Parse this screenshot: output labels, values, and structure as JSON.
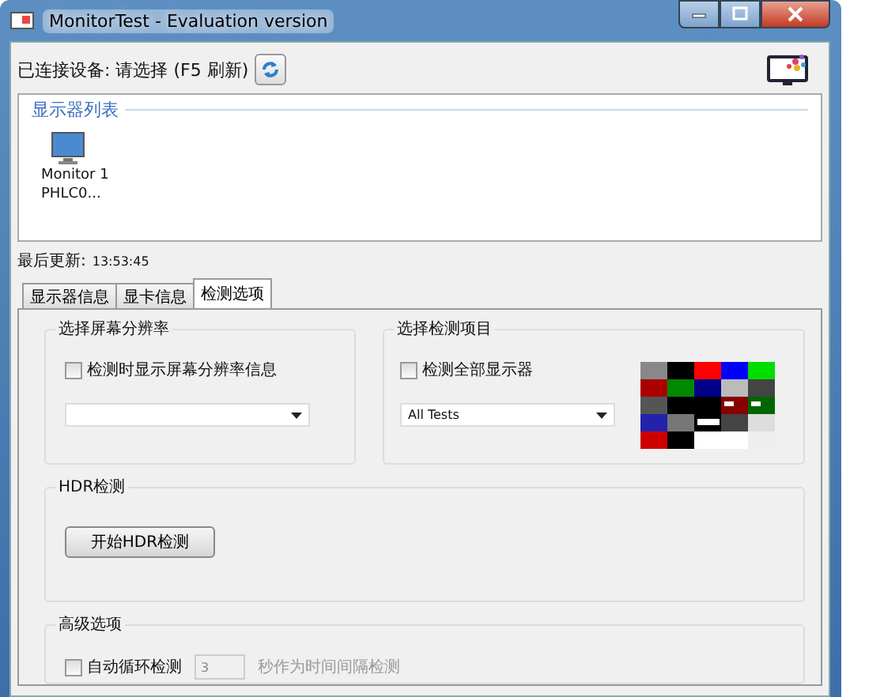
{
  "window": {
    "title": "MonitorTest - Evaluation version"
  },
  "device": {
    "label": "已连接设备: 请选择 (F5 刷新)"
  },
  "monitor_list": {
    "title": "显示器列表",
    "monitors": [
      {
        "name": "Monitor 1",
        "model": "PHLC0...",
        "selected": false
      }
    ]
  },
  "last_update": {
    "label": "最后更新:",
    "time": "13:53:45"
  },
  "tabs": [
    {
      "label": "显示器信息",
      "selected": false
    },
    {
      "label": "显卡信息",
      "selected": false
    },
    {
      "label": "检测选项",
      "selected": true
    }
  ],
  "resolution_group": {
    "title": "选择屏幕分辨率",
    "checkbox": {
      "label": "检测时显示屏幕分辨率信息",
      "checked": false
    }
  },
  "test_group": {
    "title": "选择检测项目",
    "checkbox": {
      "label": "检测全部显示器",
      "checked": false
    },
    "dropdown": {
      "value": "All Tests"
    }
  },
  "hdr_group": {
    "title": "HDR检测",
    "button": "开始HDR检测"
  },
  "advanced_group": {
    "title": "高级选项",
    "checkbox": {
      "label": "自动循环检测",
      "checked": false
    },
    "interval": {
      "value": "3",
      "disabled": true
    },
    "suffix": {
      "text": "秒作为时间间隔检测",
      "disabled": true
    }
  }
}
